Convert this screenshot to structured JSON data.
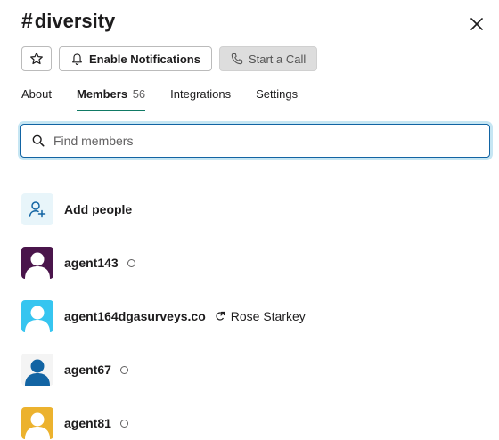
{
  "header": {
    "title": "diversity",
    "hash": "#",
    "enable_notifications_label": "Enable Notifications",
    "start_call_label": "Start a Call"
  },
  "tabs": [
    {
      "label": "About"
    },
    {
      "label": "Members",
      "count": "56"
    },
    {
      "label": "Integrations"
    },
    {
      "label": "Settings"
    }
  ],
  "search": {
    "placeholder": "Find members",
    "value": ""
  },
  "add_people_label": "Add people",
  "members": [
    {
      "name": "agent143",
      "avatar_color": "#4a154b"
    },
    {
      "name": "agent164dgasurveys.co",
      "avatar_color": "#36c5f0",
      "external_name": "Rose Starkey"
    },
    {
      "name": "agent67",
      "avatar_color": "#1264a3"
    },
    {
      "name": "agent81",
      "avatar_color": "#ecb22e"
    }
  ],
  "colors": {
    "accent": "#117a65",
    "focus": "#1264a3"
  }
}
